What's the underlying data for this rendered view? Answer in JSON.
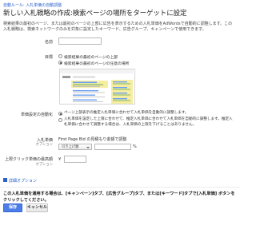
{
  "breadcrumb": "自動ルール: 入札単価の自動調整",
  "title": "新しい入札戦略の作成:検索ページの場所をターゲットに設定",
  "description": "検索結果の最初のページ、または最初のページの上部に広告を表示するための入札単価をAdWordsで自動的に調整します。この入札戦略は、検索ネットワークのみを対象に設定したキーワード、広告グループ、キャンペーンで使用できます。",
  "name": {
    "label": "名前",
    "value": ""
  },
  "target": {
    "label": "目標",
    "options": [
      {
        "label": "検索結果の最初のページの上部",
        "selected": false
      },
      {
        "label": "検索結果の最初のページの任意の場所",
        "selected": true
      }
    ]
  },
  "auto_adjust": {
    "label": "単価設定の自動化",
    "options": [
      {
        "label": "ページ上部表示の推定入札単価に合わせて入札単価を自動的に調整します。",
        "selected": true
      },
      {
        "label": "入札単価を設定した上限に合わせて、推定入札単価に合わせて入札単価を自動的に調整します。推定入札単価に合わせて調整する場合は、入札単価の上限を下げることはありません。",
        "selected": false
      }
    ]
  },
  "bid_change": {
    "label": "入札単価",
    "optional": "オプション",
    "heading": "First Page Bid の見積もり金額で調整",
    "select_value": "引き上げ額",
    "value": "",
    "unit": "%"
  },
  "max_cpc": {
    "label": "上限クリック単価の最高額",
    "optional": "オプション",
    "currency": "¥",
    "value": ""
  },
  "advanced_link": "詳細オプション",
  "note": "この入札単価を適用する場合は、[キャンペーン]タブ、[広告グループ]タブ、または[キーワード]タブで[入札単価] ボタンをクリックしてください。",
  "buttons": {
    "save": "保存",
    "cancel": "キャンセル"
  },
  "colors": {
    "accent": "#4d7de6",
    "link": "#2a62c9",
    "preview_top": "#6ba0f0",
    "preview_highlight": "#f6eda1",
    "preview_green": "#7fb86a"
  }
}
